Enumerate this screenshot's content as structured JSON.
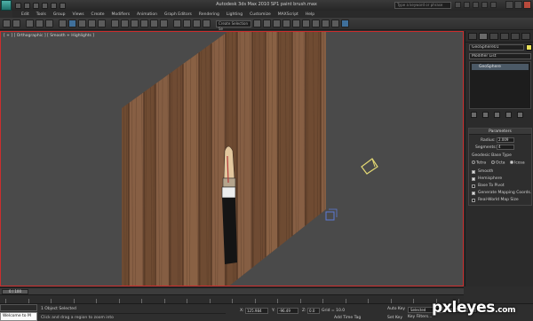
{
  "app": {
    "window_title": "Autodesk 3ds Max 2010 SP1    paint brush.max",
    "logo_letter": "",
    "search_placeholder": "Type a keyword or phrase"
  },
  "menu": [
    "Edit",
    "Tools",
    "Group",
    "Views",
    "Create",
    "Modifiers",
    "Animation",
    "Graph Editors",
    "Rendering",
    "Lighting",
    "Customize",
    "MAXScript",
    "Help"
  ],
  "toolbar": {
    "selection_dropdown": "Create Selection Se"
  },
  "viewport": {
    "label": "[ + ] [ Orthographic ] [ Smooth + Highlights ]"
  },
  "command_panel": {
    "object_name": "GeoSphere01",
    "modifier_list": "Modifier List",
    "stack_item": "GeoSphere",
    "parameters": {
      "title": "Parameters",
      "radius_label": "Radius:",
      "radius_value": "2.009",
      "segments_label": "Segments:",
      "segments_value": "4",
      "base_type_label": "Geodesic Base Type",
      "types": [
        "Tetra",
        "Octa",
        "Icosa"
      ],
      "selected_type": "Icosa",
      "options": [
        {
          "label": "Smooth",
          "checked": true
        },
        {
          "label": "Hemisphere",
          "checked": true
        },
        {
          "label": "Base To Pivot",
          "checked": false
        },
        {
          "label": "Generate Mapping Coords.",
          "checked": true
        },
        {
          "label": "Real-World Map Size",
          "checked": false
        }
      ]
    }
  },
  "timeline": {
    "frame_display": "0 / 100",
    "progress": 0
  },
  "status": {
    "maxscript": "Welcome to M",
    "line1": "1 Object Selected",
    "line2": "Click and drag a region to zoom into",
    "x_label": "X:",
    "x_value": "125.984",
    "y_label": "Y:",
    "y_value": "-96.49",
    "z_label": "Z:",
    "z_value": "0.0",
    "grid": "Grid = 10.0",
    "add_time_tag": "Add Time Tag",
    "auto_key": "Auto Key",
    "set_key": "Set Key",
    "selected_field": "Selected",
    "key_filters": "Key Filters..."
  },
  "watermark": {
    "text": "pxleyes",
    "suffix": ".com"
  },
  "colors": {
    "viewport_border": "#cc2d2d",
    "wood_light": "#8a6246",
    "wood_dark": "#4e3322",
    "brush_tip": "#e5c9a3",
    "brush_handle": "#141414"
  }
}
